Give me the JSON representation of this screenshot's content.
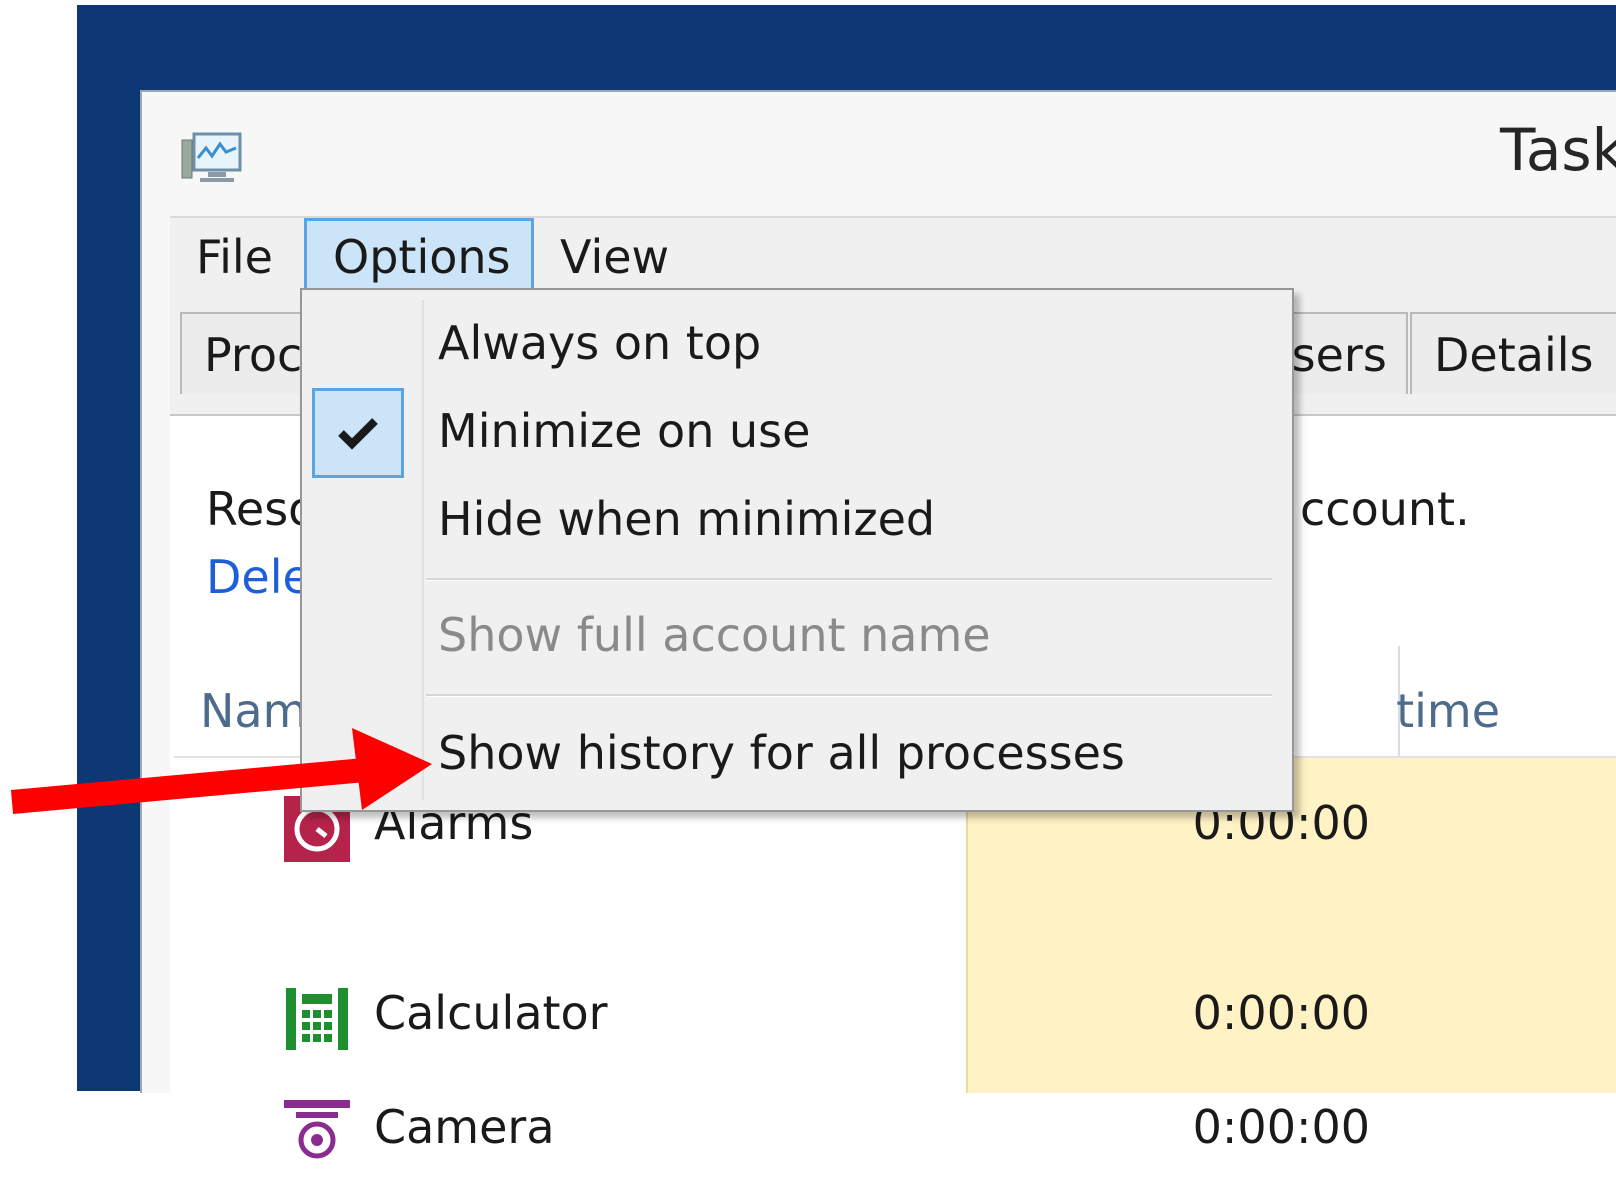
{
  "window": {
    "title": "Task"
  },
  "menubar": {
    "file": "File",
    "options": "Options",
    "view": "View"
  },
  "tabs": {
    "processes": "Proc",
    "users": "Users",
    "details": "Details"
  },
  "content": {
    "description_start": "Reso",
    "description_end": "ccount.",
    "delete_link": "Dele",
    "name_header": "Nam",
    "time_header": "time"
  },
  "rows": [
    {
      "name": "Alarms",
      "time": "0:00:00"
    },
    {
      "name": "Calculator",
      "time": "0:00:00"
    },
    {
      "name": "Camera",
      "time": "0:00:00"
    }
  ],
  "options_menu": {
    "items": [
      {
        "label": "Always on top",
        "checked": false
      },
      {
        "label": "Minimize on use",
        "checked": true
      },
      {
        "label": "Hide when minimized",
        "checked": false
      },
      {
        "label": "Show full account name",
        "disabled": true
      },
      {
        "label": "Show history for all processes",
        "disabled": false
      }
    ]
  },
  "colors": {
    "desktop": "#0d3873",
    "menu_highlight": "#cce4f7",
    "menu_highlight_border": "#5ba4e0",
    "column_highlight": "#fff2c4",
    "link": "#1e5fd8",
    "annotation_arrow": "#ff0000"
  },
  "icons": {
    "app": "task-manager-icon",
    "alarms": "alarms-icon",
    "calculator": "calculator-icon",
    "camera": "camera-icon",
    "check": "checkmark-icon"
  }
}
